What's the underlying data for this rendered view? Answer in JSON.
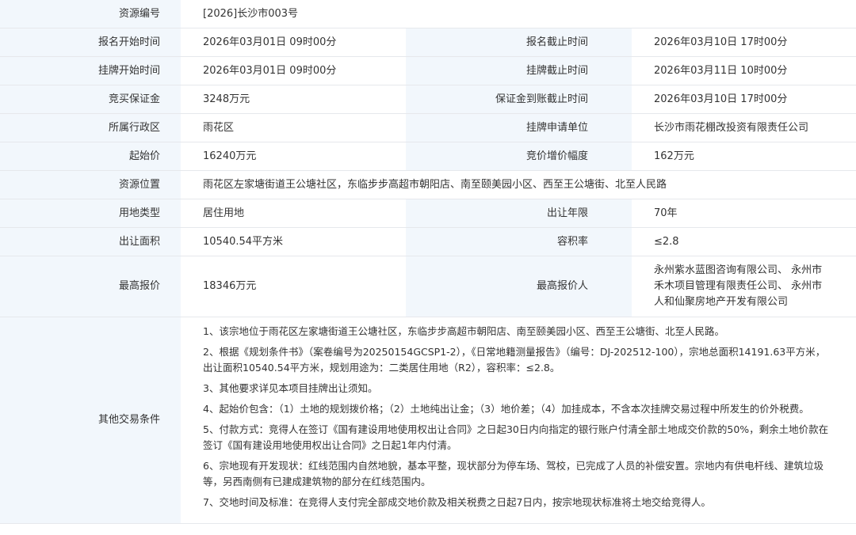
{
  "rows": {
    "resource_no": {
      "label": "资源编号",
      "value": "[2026]长沙市003号"
    },
    "reg_start": {
      "label": "报名开始时间",
      "value": "2026年03月01日 09时00分"
    },
    "reg_end": {
      "label": "报名截止时间",
      "value": "2026年03月10日 17时00分"
    },
    "list_start": {
      "label": "挂牌开始时间",
      "value": "2026年03月01日 09时00分"
    },
    "list_end": {
      "label": "挂牌截止时间",
      "value": "2026年03月11日 10时00分"
    },
    "deposit": {
      "label": "竞买保证金",
      "value": "3248万元"
    },
    "deposit_deadline": {
      "label": "保证金到账截止时间",
      "value": "2026年03月10日 17时00分"
    },
    "district": {
      "label": "所属行政区",
      "value": "雨花区"
    },
    "applicant": {
      "label": "挂牌申请单位",
      "value": "长沙市雨花棚改投资有限责任公司"
    },
    "start_price": {
      "label": "起始价",
      "value": "16240万元"
    },
    "increment": {
      "label": "竞价增价幅度",
      "value": "162万元"
    },
    "location": {
      "label": "资源位置",
      "value": "雨花区左家塘街道王公塘社区，东临步步高超市朝阳店、南至颐美园小区、西至王公塘街、北至人民路"
    },
    "land_use": {
      "label": "用地类型",
      "value": "居住用地"
    },
    "term": {
      "label": "出让年限",
      "value": "70年"
    },
    "area": {
      "label": "出让面积",
      "value": "10540.54平方米"
    },
    "far": {
      "label": "容积率",
      "value": "≤2.8"
    },
    "highest_bid": {
      "label": "最高报价",
      "value": "18346万元"
    },
    "highest_bidder": {
      "label": "最高报价人",
      "value": "永州紫水蓝图咨询有限公司、 永州市禾木项目管理有限责任公司、 永州市人和仙聚房地产开发有限公司"
    }
  },
  "terms": {
    "label": "其他交易条件",
    "items": [
      "1、该宗地位于雨花区左家塘街道王公塘社区，东临步步高超市朝阳店、南至颐美园小区、西至王公塘街、北至人民路。",
      "2、根据《规划条件书》（案卷编号为20250154GCSP1-2），《日常地籍测量报告》（编号：DJ-202512-100），宗地总面积14191.63平方米，出让面积10540.54平方米，规划用途为：二类居住用地（R2），容积率：≤2.8。",
      "3、其他要求详见本项目挂牌出让须知。",
      "4、起始价包含：（1）土地的规划拨价格；（2）土地纯出让金；（3）地价差；（4）加挂成本，不含本次挂牌交易过程中所发生的价外税费。",
      "5、付款方式：竞得人在签订《国有建设用地使用权出让合同》之日起30日内向指定的银行账户付清全部土地成交价款的50%，剩余土地价款在签订《国有建设用地使用权出让合同》之日起1年内付清。",
      "6、宗地现有开发现状：红线范围内自然地貌，基本平整，现状部分为停车场、驾校，已完成了人员的补偿安置。宗地内有供电杆线、建筑垃圾等，另西南侧有已建成建筑物的部分在红线范围内。",
      "7、交地时间及标准：在竞得人支付完全部成交地价款及相关税费之日起7日内，按宗地现状标准将土地交给竞得人。"
    ]
  }
}
